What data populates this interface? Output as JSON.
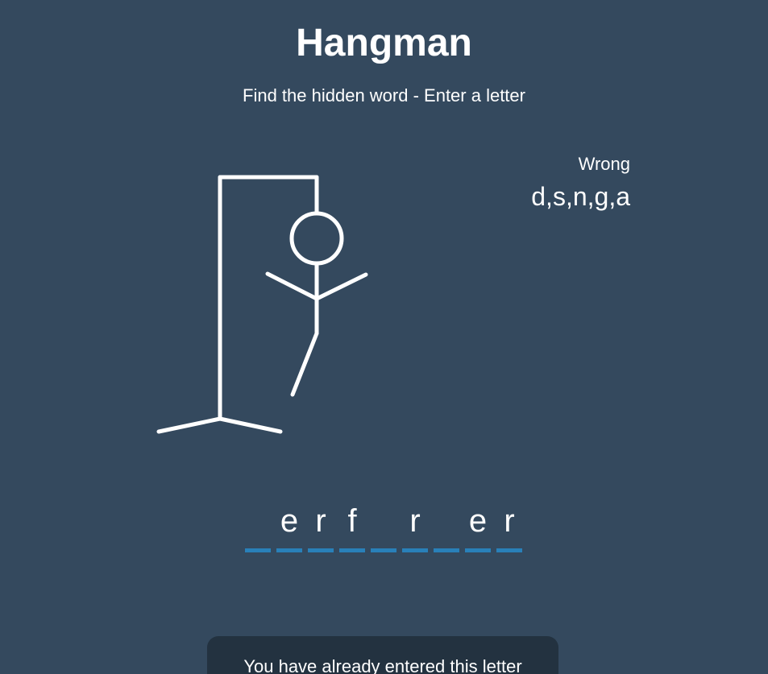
{
  "header": {
    "title": "Hangman",
    "subtitle": "Find the hidden word - Enter a letter"
  },
  "wrong": {
    "label": "Wrong",
    "letters": "d,s,n,g,a"
  },
  "word": {
    "slots": [
      "",
      "e",
      "r",
      "f",
      "",
      "r",
      "",
      "e",
      "r"
    ]
  },
  "notification": {
    "text": "You have already entered this letter"
  },
  "game_state": {
    "wrong_count": 5,
    "parts_drawn": [
      "head",
      "body",
      "left-arm",
      "right-arm",
      "left-leg"
    ]
  },
  "colors": {
    "background": "#34495e",
    "accent": "#2980b9",
    "figure": "#ffffff",
    "notification_bg": "#233240"
  }
}
